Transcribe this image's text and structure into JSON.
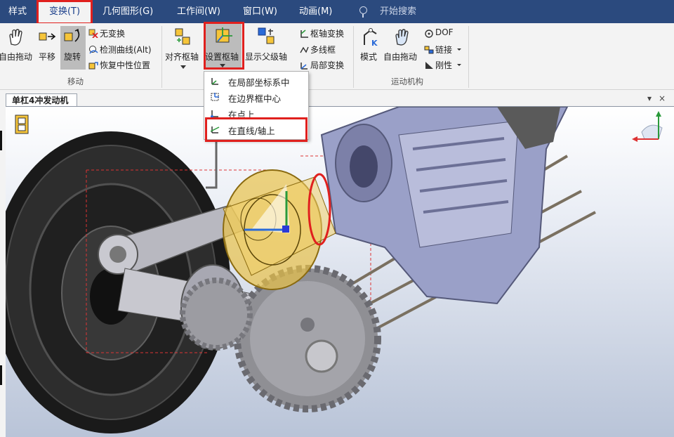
{
  "menu": {
    "items": [
      "样式",
      "变换(T)",
      "几何图形(G)",
      "工作间(W)",
      "窗口(W)",
      "动画(M)"
    ],
    "search_placeholder": "开始搜索"
  },
  "ribbon": {
    "move_group": {
      "free_drag": "自由拖动",
      "translate": "平移",
      "rotate": "旋转",
      "no_transform": "无变换",
      "detect_curve": "检测曲线(Alt)",
      "restore_neutral": "恢复中性位置",
      "group_label": "移动"
    },
    "pivot_group": {
      "align_pivot": "对齐枢轴",
      "set_pivot": "设置枢轴",
      "show_parent": "显示父级轴",
      "pivot_transform": "枢轴变换",
      "polyline_box": "多线框",
      "local_transform": "局部变换"
    },
    "mechanism_group": {
      "mode": "模式",
      "free_drag": "自由拖动",
      "dof": "DOF",
      "link": "链接",
      "rigid": "刚性",
      "group_label": "运动机构"
    }
  },
  "document": {
    "tab_title": "单杠4冲发动机",
    "controls": [
      "▾",
      "×"
    ]
  },
  "pivot_dropdown": {
    "items": [
      "在局部坐标系中",
      "在边界框中心",
      "在点上",
      "在直线/轴上"
    ]
  },
  "colors": {
    "menubar": "#2b4a7e",
    "highlight_box": "#e0201e",
    "pivot_part": "#e8c24a",
    "engine_metal": "#9aa0c8"
  }
}
